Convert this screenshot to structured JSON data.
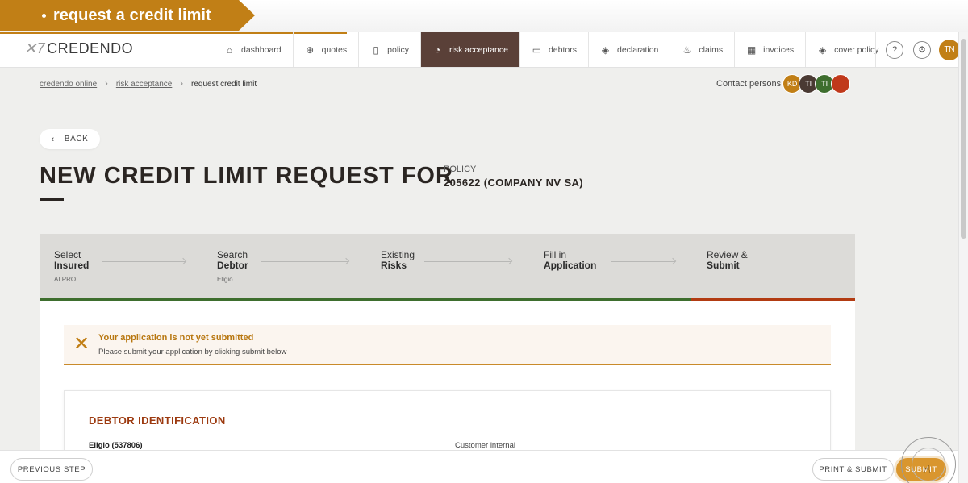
{
  "banner": {
    "label": "request a credit limit"
  },
  "nav": {
    "logo": "CREDENDO",
    "items": [
      {
        "label": "dashboard",
        "icon": "home-icon",
        "glyph": "⌂",
        "active": false
      },
      {
        "label": "quotes",
        "icon": "plus-circle-icon",
        "glyph": "⊕",
        "active": false
      },
      {
        "label": "policy",
        "icon": "document-icon",
        "glyph": "▯",
        "active": false
      },
      {
        "label": "risk acceptance",
        "icon": "gauge-icon",
        "glyph": "◔",
        "active": true
      },
      {
        "label": "debtors",
        "icon": "folder-icon",
        "glyph": "▭",
        "active": false
      },
      {
        "label": "declaration",
        "icon": "layers-icon",
        "glyph": "◈",
        "active": false
      },
      {
        "label": "claims",
        "icon": "flame-icon",
        "glyph": "♨",
        "active": false
      },
      {
        "label": "invoices",
        "icon": "grid-icon",
        "glyph": "▦",
        "active": false
      },
      {
        "label": "cover policy",
        "icon": "stack-icon",
        "glyph": "◈",
        "active": false
      }
    ],
    "help_glyph": "?",
    "settings_glyph": "⚙",
    "user_initials": "TN"
  },
  "breadcrumb": {
    "items": [
      "credendo online",
      "risk acceptance"
    ],
    "current": "request credit limit"
  },
  "contacts": {
    "label": "Contact persons",
    "people": [
      {
        "initials": "KD",
        "color": "#c17f16"
      },
      {
        "initials": "TI",
        "color": "#4a3a33"
      },
      {
        "initials": "TI",
        "color": "#3e6e2e"
      },
      {
        "initials": "",
        "color": "#c0391b"
      }
    ]
  },
  "back_button": "BACK",
  "title": "NEW CREDIT LIMIT REQUEST FOR",
  "policy": {
    "label": "POLICY",
    "value": "205622 (COMPANY NV SA)"
  },
  "steps": [
    {
      "line1": "Select",
      "line2": "Insured",
      "sub": "ALPRO"
    },
    {
      "line1": "Search",
      "line2": "Debtor",
      "sub": "Eligio"
    },
    {
      "line1": "Existing",
      "line2": "Risks",
      "sub": ""
    },
    {
      "line1": "Fill in",
      "line2": "Application",
      "sub": ""
    },
    {
      "line1": "Review &",
      "line2": "Submit",
      "sub": ""
    }
  ],
  "alert": {
    "title": "Your application is not yet submitted",
    "message": "Please submit your application by clicking submit below"
  },
  "debtor_card": {
    "heading": "DEBTOR IDENTIFICATION",
    "name": "Eligio (537806)",
    "customer_field": "Customer internal"
  },
  "footer": {
    "previous": "PREVIOUS STEP",
    "print_submit": "PRINT & SUBMIT",
    "submit": "SUBMIT"
  },
  "colors": {
    "accent": "#c17f16",
    "active_nav": "#5a4038",
    "progress_done": "#3e6e2e",
    "progress_current": "#b23b12",
    "section_heading": "#9c3a10"
  }
}
